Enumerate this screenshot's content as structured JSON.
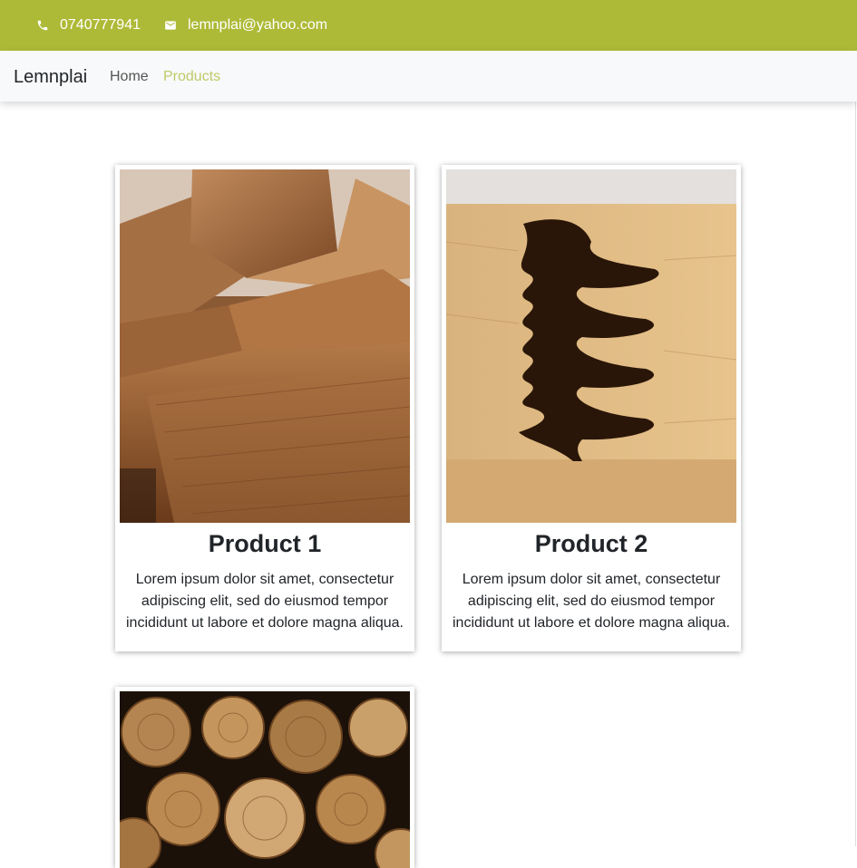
{
  "topbar": {
    "phone": "0740777941",
    "email": "lemnplai@yahoo.com",
    "phone_icon": "phone-icon",
    "email_icon": "mail-icon",
    "background": "#adba37"
  },
  "navbar": {
    "brand": "Lemnplai",
    "links": [
      {
        "label": "Home",
        "active": false
      },
      {
        "label": "Products",
        "active": true
      }
    ]
  },
  "products": [
    {
      "title": "Product 1",
      "description": "Lorem ipsum dolor sit amet, consectetur adipiscing elit, sed do eiusmod tempor incididunt ut labore et dolore magna aliqua.",
      "image": "stacked-timber-boards"
    },
    {
      "title": "Product 2",
      "description": "Lorem ipsum dolor sit amet, consectetur adipiscing elit, sed do eiusmod tempor incididunt ut labore et dolore magna aliqua.",
      "image": "dovetail-wood-joint"
    },
    {
      "title": "",
      "description": "",
      "image": "stacked-firewood-logs"
    }
  ]
}
